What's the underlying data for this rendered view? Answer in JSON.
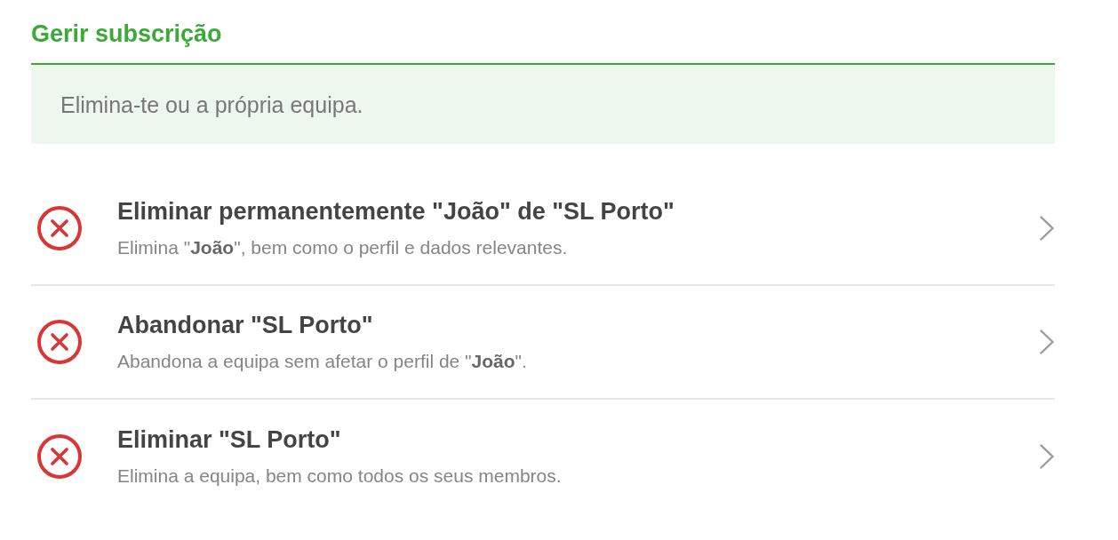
{
  "section": {
    "title": "Gerir subscrição",
    "info": "Elimina-te ou a própria equipa."
  },
  "actions": [
    {
      "title": "Eliminar permanentemente \"João\" de \"SL Porto\"",
      "description": "Elimina \"**João**\", bem como o perfil e dados relevantes."
    },
    {
      "title": "Abandonar \"SL Porto\"",
      "description": "Abandona a equipa sem afetar o perfil de \"**João**\"."
    },
    {
      "title": "Eliminar \"SL Porto\"",
      "description": "Elimina a equipa, bem como todos os seus membros."
    }
  ]
}
